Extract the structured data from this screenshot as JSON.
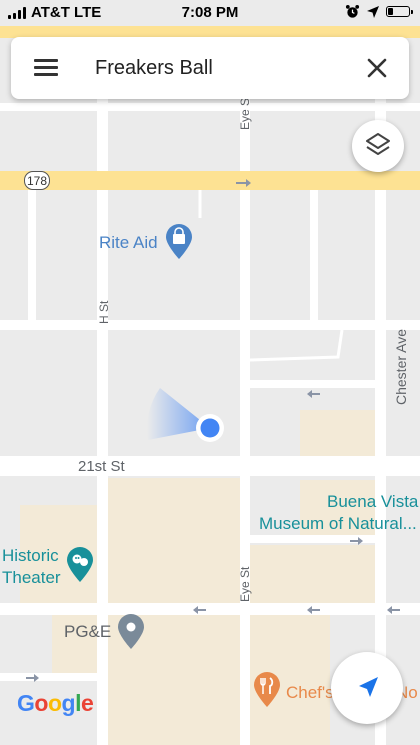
{
  "status_bar": {
    "carrier": "AT&T LTE",
    "time": "7:08 PM"
  },
  "search": {
    "query": "Freakers Ball"
  },
  "map": {
    "highway_shield": "178",
    "streets": {
      "eye_st": "Eye St",
      "h_st": "H St",
      "chester_ave": "Chester Ave",
      "twenty_first_st": "21st St"
    },
    "pois": {
      "rite_aid": "Rite Aid",
      "buena_vista_1": "Buena Vista",
      "buena_vista_2": "Museum of Natural...",
      "historic_theater_1": "Historic",
      "historic_theater_2": "Theater",
      "pge": "PG&E",
      "chefs": "Chef's Choice No"
    },
    "attribution": "Google",
    "colors": {
      "background": "#ebebeb",
      "road": "#ffffff",
      "highway": "#fde293",
      "building": "#f3ead7",
      "location_dot": "#4285f4"
    }
  },
  "icons": {
    "menu": "menu-icon",
    "close": "close-icon",
    "layers": "layers-icon",
    "navigate": "navigation-arrow-icon",
    "shopping_pin": "shopping-bag-pin-icon",
    "museum_pin": "museum-pin-icon",
    "theater_pin": "theater-pin-icon",
    "place_pin": "place-pin-icon",
    "restaurant_pin": "restaurant-pin-icon"
  }
}
